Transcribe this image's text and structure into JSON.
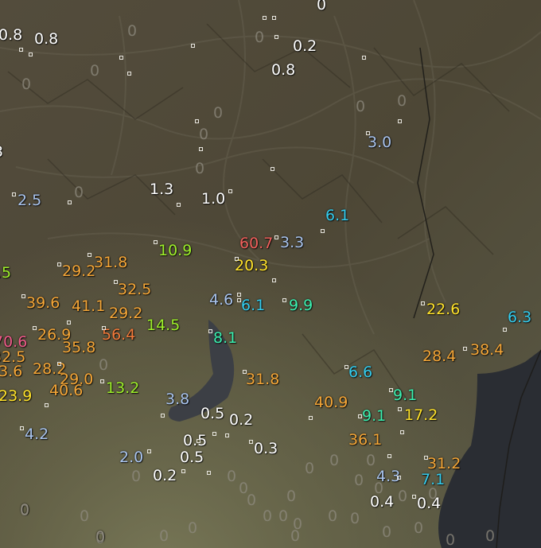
{
  "colors": {
    "white": "#ffffff",
    "light_blue": "#a9c4ee",
    "cyan": "#33ccee",
    "teal": "#3bf0b0",
    "green": "#9ef02a",
    "yellow": "#ffe22a",
    "orange": "#f5a637",
    "dark_orange": "#f27a3a",
    "red": "#f0605c",
    "pink": "#f05a8a",
    "zero": "#8e8a7e"
  },
  "labels": [
    {
      "text": "0.8",
      "color": "white"
    },
    {
      "text": "0.8",
      "color": "white"
    },
    {
      "text": "0",
      "color": "white"
    },
    {
      "text": "0.2",
      "color": "white"
    },
    {
      "text": "0.8",
      "color": "white"
    },
    {
      "text": "3",
      "color": "white"
    },
    {
      "text": "3.0",
      "color": "light_blue"
    },
    {
      "text": "2.5",
      "color": "light_blue"
    },
    {
      "text": "1.3",
      "color": "white"
    },
    {
      "text": "1.0",
      "color": "white"
    },
    {
      "text": "6.1",
      "color": "cyan"
    },
    {
      "text": "60.7",
      "color": "red"
    },
    {
      "text": "3.3",
      "color": "light_blue"
    },
    {
      "text": "10.9",
      "color": "green"
    },
    {
      "text": "20.3",
      "color": "yellow"
    },
    {
      "text": ".5",
      "color": "green"
    },
    {
      "text": "29.2",
      "color": "orange"
    },
    {
      "text": "31.8",
      "color": "orange"
    },
    {
      "text": "32.5",
      "color": "orange"
    },
    {
      "text": "39.6",
      "color": "orange"
    },
    {
      "text": "41.1",
      "color": "orange"
    },
    {
      "text": "29.2",
      "color": "orange"
    },
    {
      "text": "4.6",
      "color": "light_blue"
    },
    {
      "text": "6.1",
      "color": "cyan"
    },
    {
      "text": "9.9",
      "color": "teal"
    },
    {
      "text": "22.6",
      "color": "yellow"
    },
    {
      "text": "6.3",
      "color": "cyan"
    },
    {
      "text": "14.5",
      "color": "green"
    },
    {
      "text": "56.4",
      "color": "dark_orange"
    },
    {
      "text": "70.6",
      "color": "pink"
    },
    {
      "text": "26.9",
      "color": "orange"
    },
    {
      "text": "8.1",
      "color": "teal"
    },
    {
      "text": "32.5",
      "color": "orange"
    },
    {
      "text": "35.8",
      "color": "orange"
    },
    {
      "text": "28.4",
      "color": "orange"
    },
    {
      "text": "38.4",
      "color": "orange"
    },
    {
      "text": "23.6",
      "color": "orange"
    },
    {
      "text": "28.2",
      "color": "orange"
    },
    {
      "text": "6.6",
      "color": "cyan"
    },
    {
      "text": "29.0",
      "color": "orange"
    },
    {
      "text": "31.8",
      "color": "orange"
    },
    {
      "text": "23.9",
      "color": "yellow"
    },
    {
      "text": "40.6",
      "color": "orange"
    },
    {
      "text": "13.2",
      "color": "green"
    },
    {
      "text": "9.1",
      "color": "teal"
    },
    {
      "text": "3.8",
      "color": "light_blue"
    },
    {
      "text": "40.9",
      "color": "orange"
    },
    {
      "text": "0.5",
      "color": "white"
    },
    {
      "text": "0.2",
      "color": "white"
    },
    {
      "text": "9.1",
      "color": "teal"
    },
    {
      "text": "17.2",
      "color": "yellow"
    },
    {
      "text": "4.2",
      "color": "light_blue"
    },
    {
      "text": "0.5",
      "color": "white"
    },
    {
      "text": "36.1",
      "color": "orange"
    },
    {
      "text": "0.3",
      "color": "white"
    },
    {
      "text": "2.0",
      "color": "light_blue"
    },
    {
      "text": "0.5",
      "color": "white"
    },
    {
      "text": "31.2",
      "color": "orange"
    },
    {
      "text": "0.2",
      "color": "white"
    },
    {
      "text": "4.3",
      "color": "light_blue"
    },
    {
      "text": "7.1",
      "color": "cyan"
    },
    {
      "text": "0.4",
      "color": "white"
    },
    {
      "text": "0.4",
      "color": "white"
    },
    {
      "text": "0",
      "color": "zero"
    },
    {
      "text": "0",
      "color": "zero"
    }
  ],
  "zeros": [
    "0",
    "0",
    "0",
    "0",
    "0",
    "0",
    "0",
    "0",
    "0",
    "0",
    "0",
    "0",
    "0",
    "0",
    "0",
    "0",
    "0",
    "0",
    "0",
    "0",
    "0",
    "0",
    "0",
    "0",
    "0",
    "0",
    "0",
    "0",
    "0",
    "0",
    "0",
    "0",
    "0",
    "0",
    "0",
    "0",
    "0",
    "0"
  ]
}
